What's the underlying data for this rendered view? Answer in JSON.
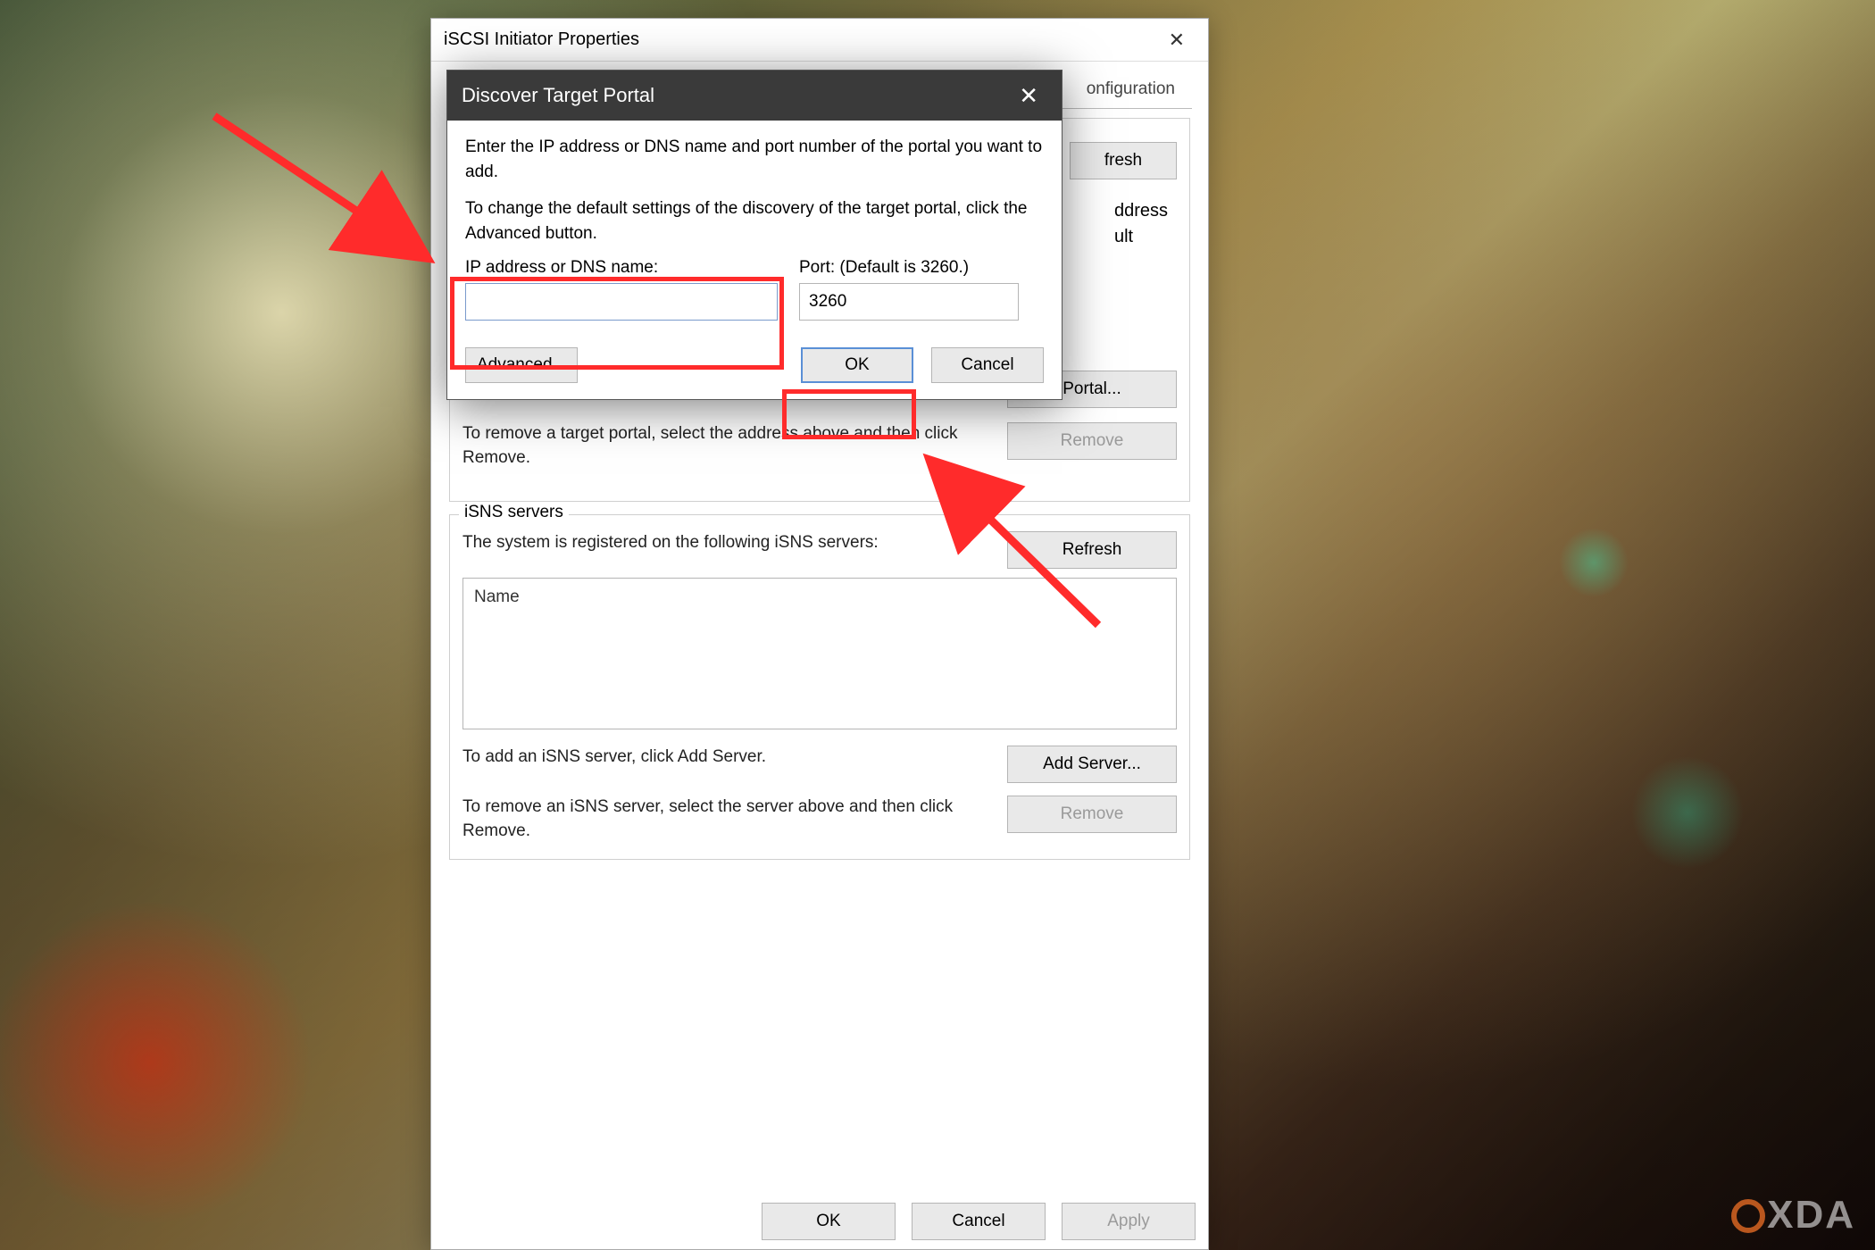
{
  "parent": {
    "title": "iSCSI Initiator Properties",
    "tabs": {
      "configuration": "onfiguration"
    },
    "targetPortals": {
      "partialButton1": "fresh",
      "partialText1a": "ddress",
      "partialText1b": "ult",
      "discoverPortal": "Portal...",
      "removeDesc": "To remove a target portal, select the address above and then click Remove.",
      "removeBtn": "Remove"
    },
    "isns": {
      "legend": "iSNS servers",
      "registeredDesc": "The system is registered on the following iSNS servers:",
      "refresh": "Refresh",
      "listHeader": "Name",
      "addDesc": "To add an iSNS server, click Add Server.",
      "addBtn": "Add Server...",
      "removeDesc": "To remove an iSNS server, select the server above and then click Remove.",
      "removeBtn": "Remove"
    },
    "buttons": {
      "ok": "OK",
      "cancel": "Cancel",
      "apply": "Apply"
    }
  },
  "modal": {
    "title": "Discover Target Portal",
    "line1": "Enter the IP address or DNS name and port number of the portal you want to add.",
    "line2": "To change the default settings of the discovery of the target portal, click the Advanced button.",
    "ipLabel": "IP address or DNS name:",
    "ipValue": "",
    "portLabel": "Port: (Default is 3260.)",
    "portValue": "3260",
    "advanced": "Advanced...",
    "ok": "OK",
    "cancel": "Cancel"
  },
  "watermark": "XDA"
}
